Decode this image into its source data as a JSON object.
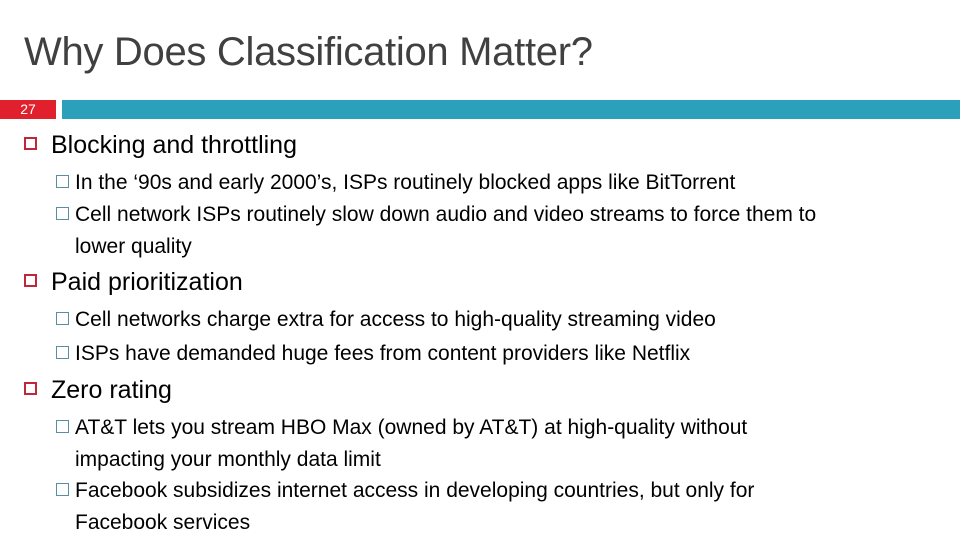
{
  "slide": {
    "title": "Why Does Classification Matter?",
    "slide_number": "27",
    "accent_colors": {
      "number_bar": "#e0202d",
      "accent_bar": "#2ba0bb",
      "bullet_l1": "#c0283a",
      "bullet_l2": "#5a8fa3"
    },
    "sections": [
      {
        "heading": "Blocking and throttling",
        "items": [
          {
            "line1": "In the ‘90s and early 2000’s, ISPs routinely blocked apps like BitTorrent",
            "line2": ""
          },
          {
            "line1": "Cell network ISPs routinely slow down audio and video streams to force them to",
            "line2": "lower quality"
          }
        ]
      },
      {
        "heading": "Paid prioritization",
        "items": [
          {
            "line1": "Cell networks charge extra for access to high-quality streaming video",
            "line2": ""
          },
          {
            "line1": "ISPs have demanded huge fees from content providers like Netflix",
            "line2": ""
          }
        ]
      },
      {
        "heading": "Zero rating",
        "items": [
          {
            "line1": "AT&T lets you stream HBO Max (owned by AT&T) at high-quality without",
            "line2": "impacting your monthly data limit"
          },
          {
            "line1": "Facebook subsidizes internet access in developing countries, but only for",
            "line2": "Facebook services"
          }
        ]
      }
    ]
  }
}
